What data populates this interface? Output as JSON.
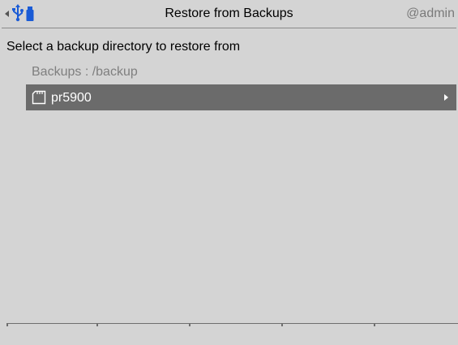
{
  "title_bar": {
    "back_icon": "back-arrow-icon",
    "usb_icon": "usb-icon",
    "title": "Restore from Backups",
    "user": "@admin"
  },
  "content": {
    "instruction": "Select a backup directory to restore from",
    "path_label": "Backups : /backup",
    "items": [
      {
        "label": "pr5900",
        "icon": "folder-icon",
        "selected": true
      }
    ]
  },
  "colors": {
    "background": "#d4d4d4",
    "selection": "#6b6b6b",
    "accent": "#1a5bd6"
  }
}
